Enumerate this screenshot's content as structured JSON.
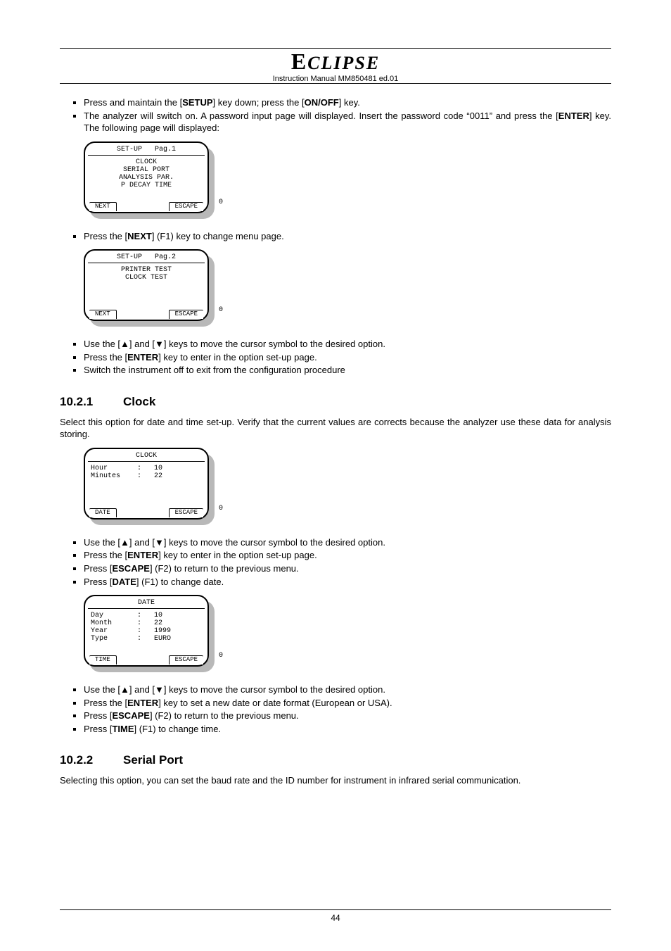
{
  "header": {
    "logo": "ECLIPSE",
    "subtitle": "Instruction Manual MM850481 ed.01"
  },
  "intro_bullets": [
    {
      "pre": "Press and maintain the [",
      "b1": "SETUP",
      "mid": "] key down; press the [",
      "b2": "ON/OFF",
      "post": "] key."
    },
    {
      "pre": "The analyzer will switch on. A password input page will displayed. Insert the password code “0011” and press the [",
      "b1": "ENTER",
      "mid": "] key. The following page will displayed:",
      "b2": "",
      "post": ""
    }
  ],
  "lcd1": {
    "title_left": "SET-UP",
    "title_right": "Pag.1",
    "lines": "CLOCK\nSERIAL PORT\nANALYSIS PAR.\nP DECAY TIME",
    "btn_left": "NEXT",
    "btn_right": "ESCAPE"
  },
  "bullet_next": {
    "pre": "Press the [",
    "b1": "NEXT",
    "post": "] (F1) key to change menu page."
  },
  "lcd2": {
    "title_left": "SET-UP",
    "title_right": "Pag.2",
    "lines": "PRINTER TEST\nCLOCK TEST",
    "btn_left": "NEXT",
    "btn_right": "ESCAPE"
  },
  "bullets_after2": [
    {
      "t": [
        "Use the [",
        "▲",
        "] and [",
        "▼",
        "] keys to move the cursor symbol to the desired option."
      ]
    },
    {
      "t": [
        "Press the [",
        "ENTER",
        "] key to enter in the option set-up page."
      ],
      "bold_idx": [
        1
      ]
    },
    {
      "t": [
        "Switch the instrument off to exit from the configuration procedure"
      ]
    }
  ],
  "sec_clock": {
    "num": "10.2.1",
    "title": "Clock"
  },
  "clock_para": "Select this option for date and time set-up. Verify that the current values are corrects because the analyzer use these data for analysis storing.",
  "lcd3": {
    "title": "CLOCK",
    "lines": "Hour       :   10\nMinutes    :   22",
    "btn_left": "DATE",
    "btn_right": "ESCAPE"
  },
  "bullets_after3": [
    {
      "t": [
        "Use the [",
        "▲",
        "] and [",
        "▼",
        "] keys to move the cursor symbol to the desired option."
      ]
    },
    {
      "t": [
        "Press the [",
        "ENTER",
        "] key to enter in the option set-up page."
      ],
      "bold_idx": [
        1
      ]
    },
    {
      "t": [
        "Press [",
        "ESCAPE",
        "] (F2) to return to the previous menu."
      ],
      "bold_idx": [
        1
      ]
    },
    {
      "t": [
        "Press [",
        "DATE",
        "] (F1) to change date."
      ],
      "bold_idx": [
        1
      ]
    }
  ],
  "lcd4": {
    "title": "DATE",
    "lines": "Day        :   10\nMonth      :   22\nYear       :   1999\nType       :   EURO",
    "btn_left": "TIME",
    "btn_right": "ESCAPE"
  },
  "bullets_after4": [
    {
      "t": [
        "Use the [",
        "▲",
        "] and [",
        "▼",
        "] keys to move the cursor symbol to the desired option."
      ]
    },
    {
      "t": [
        "Press the [",
        "ENTER",
        "] key to set a new date or date format (European or USA)."
      ],
      "bold_idx": [
        1
      ]
    },
    {
      "t": [
        "Press [",
        "ESCAPE",
        "] (F2) to return to the previous menu."
      ],
      "bold_idx": [
        1
      ]
    },
    {
      "t": [
        "Press [",
        "TIME",
        "] (F1) to change time."
      ],
      "bold_idx": [
        1
      ]
    }
  ],
  "sec_serial": {
    "num": "10.2.2",
    "title": "Serial Port"
  },
  "serial_para": "Selecting this option, you can set the baud rate and the ID number for instrument in infrared serial communication.",
  "page_number": "44",
  "zero": "0"
}
